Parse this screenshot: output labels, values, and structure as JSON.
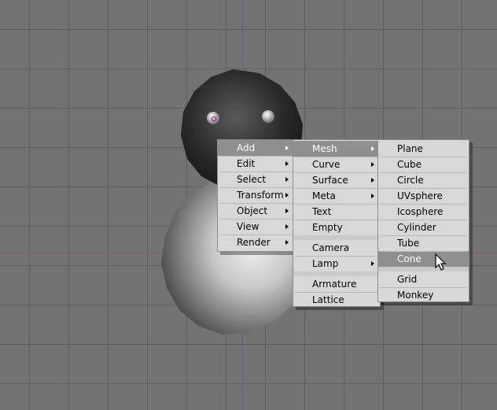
{
  "menu_main": {
    "items": [
      {
        "label": "Add",
        "submenu": true,
        "active": true
      },
      {
        "label": "Edit",
        "submenu": true
      },
      {
        "label": "Select",
        "submenu": true
      },
      {
        "label": "Transform",
        "submenu": true
      },
      {
        "label": "Object",
        "submenu": true
      },
      {
        "label": "View",
        "submenu": true
      },
      {
        "label": "Render",
        "submenu": true
      }
    ]
  },
  "menu_add": {
    "items": [
      {
        "label": "Mesh",
        "submenu": true,
        "active": true
      },
      {
        "label": "Curve",
        "submenu": true
      },
      {
        "label": "Surface",
        "submenu": true
      },
      {
        "label": "Meta",
        "submenu": true
      },
      {
        "label": "Text"
      },
      {
        "label": "Empty"
      },
      {
        "label": "Camera"
      },
      {
        "label": "Lamp",
        "submenu": true
      },
      {
        "label": "Armature"
      },
      {
        "label": "Lattice"
      }
    ]
  },
  "menu_mesh": {
    "items": [
      {
        "label": "Plane"
      },
      {
        "label": "Cube"
      },
      {
        "label": "Circle"
      },
      {
        "label": "UVsphere"
      },
      {
        "label": "Icosphere"
      },
      {
        "label": "Cylinder"
      },
      {
        "label": "Tube"
      },
      {
        "label": "Cone",
        "hovered": true
      },
      {
        "label": "Grid"
      },
      {
        "label": "Monkey"
      }
    ]
  },
  "colors": {
    "viewport_bg": "#737373",
    "grid_line": "#5e5e5e",
    "menu_bg": "#d8d8d8",
    "menu_highlight": "#8f8f8f"
  },
  "icons": {
    "cursor": "mouse-pointer-icon",
    "submenu": "submenu-arrow-icon"
  }
}
